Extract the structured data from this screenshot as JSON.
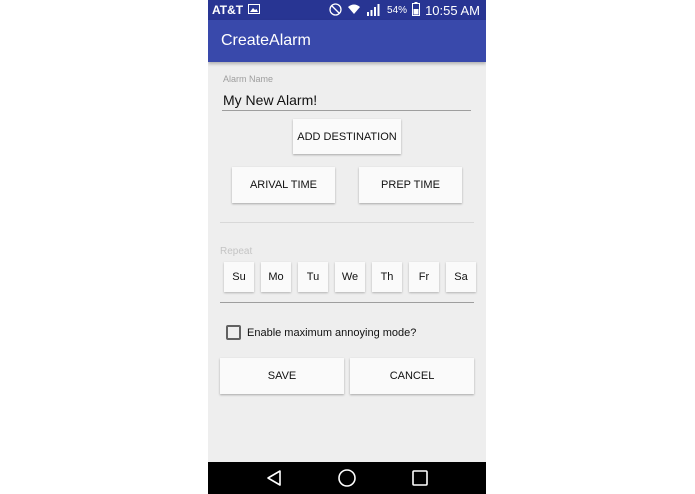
{
  "status_bar": {
    "carrier": "AT&T",
    "battery": "54%",
    "time": "10:55 AM",
    "icons": [
      "image-icon",
      "mute-icon",
      "wifi-icon",
      "signal-icon",
      "battery-icon"
    ]
  },
  "app_bar": {
    "title": "CreateAlarm"
  },
  "alarm_name": {
    "label": "Alarm Name",
    "value": "My New Alarm!"
  },
  "buttons": {
    "add_destination": "ADD DESTINATION",
    "arrival_time": "ARIVAL TIME",
    "prep_time": "PREP TIME",
    "save": "SAVE",
    "cancel": "CANCEL"
  },
  "repeat": {
    "label": "Repeat",
    "days": [
      "Su",
      "Mo",
      "Tu",
      "We",
      "Th",
      "Fr",
      "Sa"
    ]
  },
  "annoying_mode": {
    "label": "Enable maximum annoying mode?",
    "checked": false
  },
  "nav_bar": {
    "icons": [
      "back-icon",
      "home-icon",
      "recents-icon"
    ]
  },
  "colors": {
    "status_bar": "#283593",
    "app_bar": "#3949ab",
    "background": "#eeeeee"
  }
}
